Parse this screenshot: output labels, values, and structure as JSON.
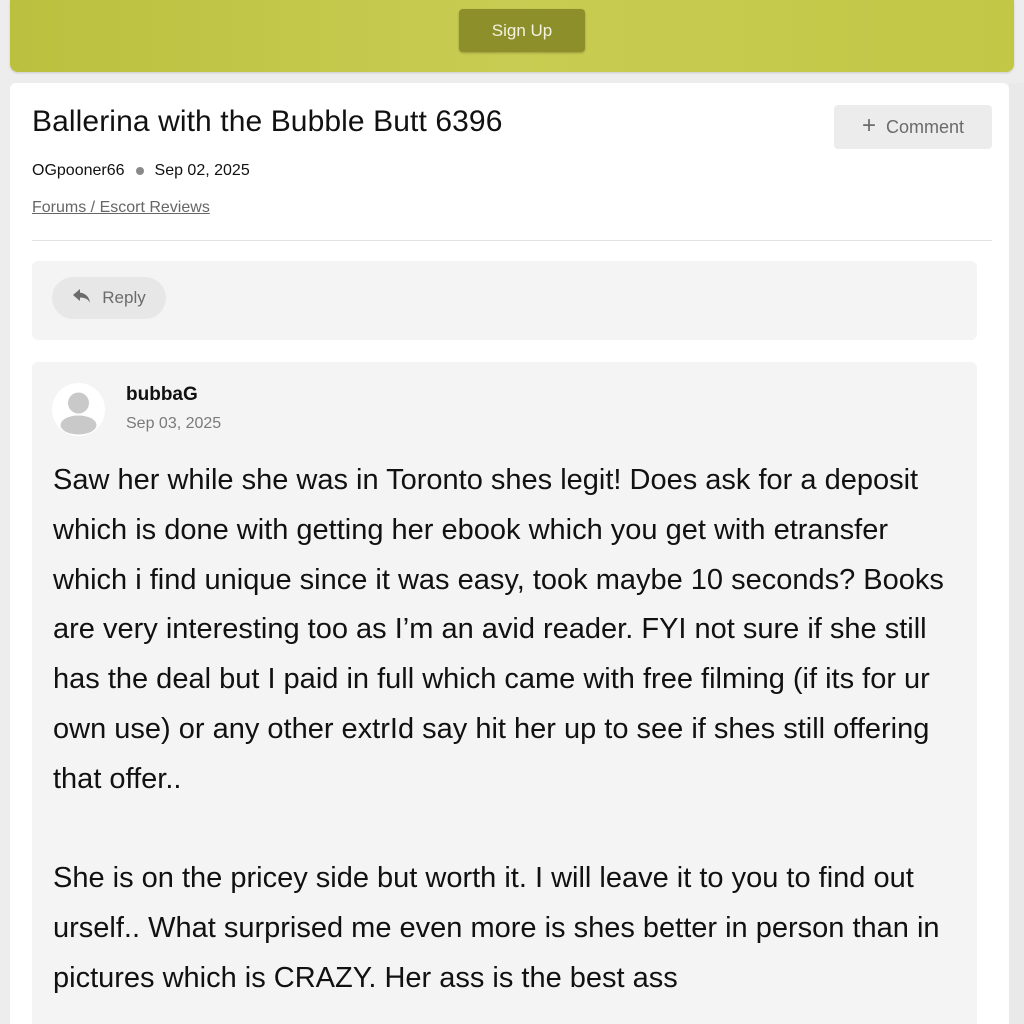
{
  "banner": {
    "signup_label": "Sign Up",
    "color": "#c4c84a"
  },
  "thread": {
    "title": "Ballerina with the Bubble Butt 6396",
    "author": "OGpooner66",
    "date": "Sep 02, 2025",
    "breadcrumb": "Forums / Escort Reviews",
    "comment_label": "Comment",
    "comment_icon": "plus-icon"
  },
  "reply_bar": {
    "reply_label": "Reply",
    "reply_icon": "reply-arrow-icon"
  },
  "post": {
    "username": "bubbaG",
    "date": "Sep 03, 2025",
    "avatar_icon": "default-user-avatar-icon",
    "paragraphs": [
      "Saw her while she was in Toronto shes legit! Does ask for a deposit which is done with getting her ebook which you get with etransfer which i find unique since it was easy, took maybe 10 seconds? Books are very interesting too as I’m an avid reader. FYI not sure if she still has the deal but I paid in full which came with free filming (if its for ur own use) or any other extrId say hit her up to see if shes still offering that offer..",
      "She is on the pricey side but worth it. I will leave it to you to find out urself.. What surprised me even more is shes better in person than in pictures which is CRAZY. Her ass is the best ass"
    ]
  }
}
